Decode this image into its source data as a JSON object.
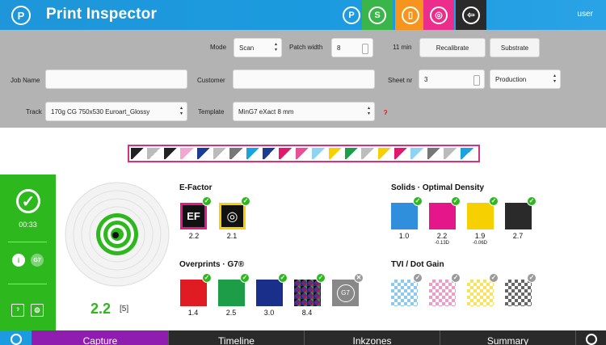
{
  "header": {
    "logo_letter": "P",
    "title": "Print Inspector",
    "user": "user",
    "buttons": [
      {
        "name": "print-icon",
        "glyph": "P",
        "bg": "#1c9be0"
      },
      {
        "name": "substrate-icon",
        "glyph": "S",
        "bg": "#39b54a"
      },
      {
        "name": "document-icon",
        "glyph": "▯",
        "bg": "#f7941d"
      },
      {
        "name": "target-icon",
        "glyph": "◎",
        "bg": "#ec2d8c"
      },
      {
        "name": "logout-icon",
        "glyph": "⇦",
        "bg": "#2a2a2a"
      }
    ]
  },
  "toolbar": {
    "mode_label": "Mode",
    "mode_value": "Scan",
    "patch_width_label": "Patch width",
    "patch_width_value": "8",
    "time_label": "11 min",
    "recalibrate": "Recalibrate",
    "substrate": "Substrate",
    "job_name_label": "Job Name",
    "job_name_value": "",
    "customer_label": "Customer",
    "customer_value": "",
    "sheet_nr_label": "Sheet nr",
    "sheet_nr_value": "3",
    "production_value": "Production",
    "track_label": "Track",
    "track_value": "170g CG 750x530 Euroart_Glossy",
    "template_label": "Template",
    "template_value": "MinG7 eXact 8 mm"
  },
  "strip": {
    "patches": [
      "#222",
      "#bbb",
      "#222",
      "#f3a6cf",
      "#1b3c94",
      "#bbb",
      "#777",
      "#19a3e0",
      "#1b3c94",
      "#e3186c",
      "#ec4e96",
      "#8fd3f3",
      "#f7d000",
      "#1d9e48",
      "#bdbdbd",
      "#f7d000",
      "#e3186c",
      "#8fd3f3",
      "#777",
      "#bbb",
      "#19a3e0"
    ]
  },
  "status": {
    "time": "00:33",
    "info_label": "i",
    "g7_label": "G7"
  },
  "target": {
    "score": "2.2",
    "count": "[5]"
  },
  "efactor": {
    "title": "E-Factor",
    "items": [
      {
        "label": "EF",
        "value": "2.2"
      },
      {
        "label": "◎",
        "value": "2.1"
      }
    ]
  },
  "overprints": {
    "title": "Overprints · G7®",
    "items": [
      {
        "color": "#e01b24",
        "value": "1.4"
      },
      {
        "color": "#1e9d48",
        "value": "2.5"
      },
      {
        "color": "#1a2f8a",
        "value": "3.0"
      },
      {
        "color": "#4a2a55",
        "value": "8.4"
      }
    ],
    "g7_label": "G7"
  },
  "solids": {
    "title": "Solids · Optimal Density",
    "items": [
      {
        "color": "#2f8fdc",
        "value": "1.0",
        "sub": ""
      },
      {
        "color": "#e5168a",
        "value": "2.2",
        "sub": "-0.13D"
      },
      {
        "color": "#f6d000",
        "value": "1.9",
        "sub": "-0.06D"
      },
      {
        "color": "#2a2a2a",
        "value": "2.7",
        "sub": ""
      }
    ]
  },
  "tvi": {
    "title": "TVI / Dot Gain",
    "colors": [
      "#8cc9ef",
      "#f09ac7",
      "#f7e35a",
      "#666666"
    ]
  },
  "tabs": {
    "capture": "Capture",
    "timeline": "Timeline",
    "inkzones": "Inkzones",
    "summary": "Summary"
  }
}
